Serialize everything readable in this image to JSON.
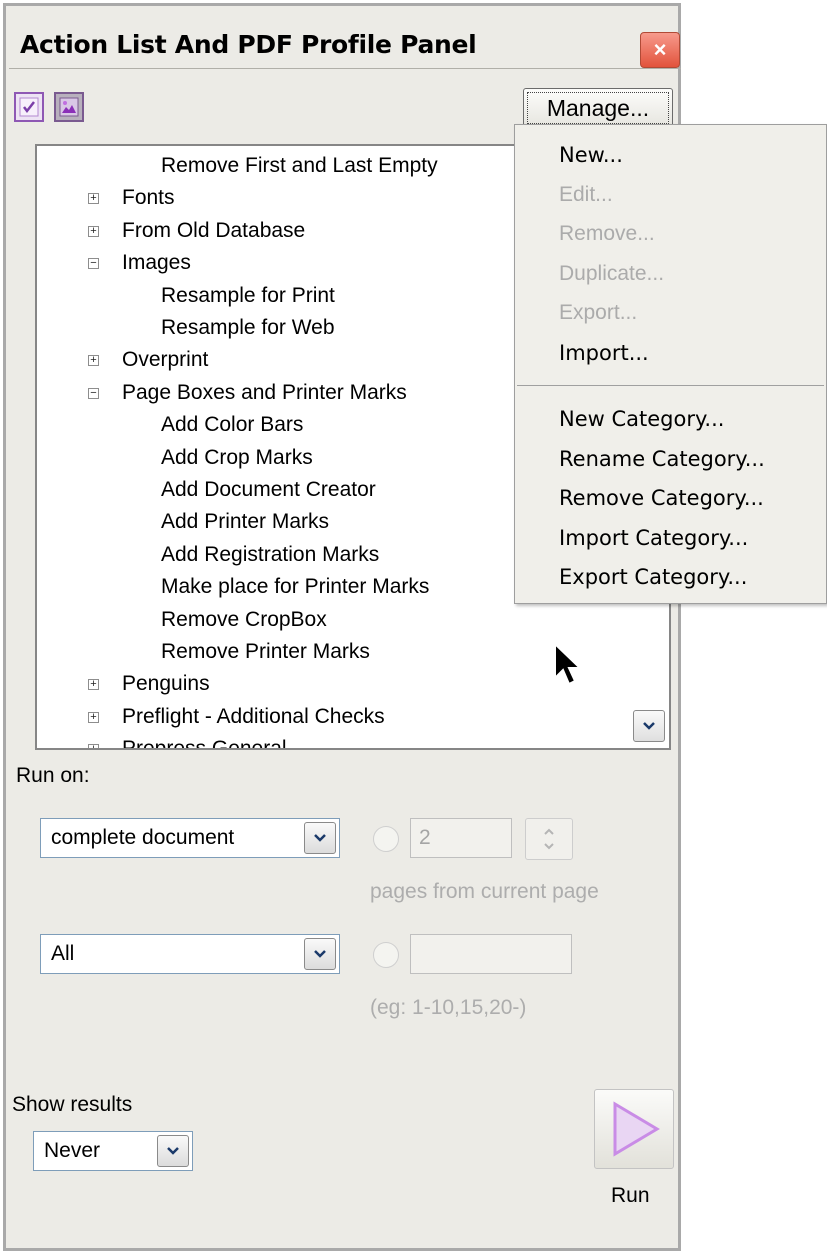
{
  "window": {
    "title": "Action List And PDF Profile Panel",
    "close_glyph": "×"
  },
  "toolbar": {
    "manage_label": "Manage...",
    "icons": [
      "checkmark-profile-icon",
      "image-profile-icon"
    ]
  },
  "tree": {
    "items": [
      {
        "label": "Remove First and Last Empty",
        "level": 2
      },
      {
        "label": "Fonts",
        "level": 1,
        "state": "collapsed"
      },
      {
        "label": "From Old Database",
        "level": 1,
        "state": "collapsed"
      },
      {
        "label": "Images",
        "level": 1,
        "state": "expanded"
      },
      {
        "label": "Resample for Print",
        "level": 2
      },
      {
        "label": "Resample for Web",
        "level": 2
      },
      {
        "label": "Overprint",
        "level": 1,
        "state": "collapsed"
      },
      {
        "label": "Page Boxes and Printer Marks",
        "level": 1,
        "state": "expanded"
      },
      {
        "label": "Add Color Bars",
        "level": 2
      },
      {
        "label": "Add Crop Marks",
        "level": 2
      },
      {
        "label": "Add Document Creator",
        "level": 2
      },
      {
        "label": "Add Printer Marks",
        "level": 2
      },
      {
        "label": "Add Registration Marks",
        "level": 2
      },
      {
        "label": "Make place for Printer Marks",
        "level": 2
      },
      {
        "label": "Remove CropBox",
        "level": 2
      },
      {
        "label": "Remove Printer Marks",
        "level": 2
      },
      {
        "label": "Penguins",
        "level": 1,
        "state": "collapsed"
      },
      {
        "label": "Preflight - Additional Checks",
        "level": 1,
        "state": "collapsed"
      },
      {
        "label": "Prepress General",
        "level": 1,
        "state": "collapsed"
      }
    ]
  },
  "manage_menu": {
    "items": [
      {
        "label": "New...",
        "enabled": true
      },
      {
        "label": "Edit...",
        "enabled": false
      },
      {
        "label": "Remove...",
        "enabled": false
      },
      {
        "label": "Duplicate...",
        "enabled": false
      },
      {
        "label": "Export...",
        "enabled": false
      },
      {
        "label": "Import...",
        "enabled": true
      },
      {
        "label": "New Category...",
        "enabled": true
      },
      {
        "label": "Rename Category...",
        "enabled": true
      },
      {
        "label": "Remove Category...",
        "enabled": true
      },
      {
        "label": "Import Category...",
        "enabled": true
      },
      {
        "label": "Export Category...",
        "enabled": true
      }
    ]
  },
  "run_on": {
    "label": "Run on:",
    "scope_value": "complete document",
    "page_count_value": "2",
    "page_count_hint": "pages from current page",
    "pages_value": "All",
    "page_range_value": "",
    "page_range_hint": "(eg: 1-10,15,20-)"
  },
  "results": {
    "label": "Show results",
    "value": "Never"
  },
  "run": {
    "label": "Run"
  },
  "colors": {
    "panel_bg": "#ecebe6",
    "close_red": "#e2533c",
    "run_triangle": "#c98ce6",
    "icon_purple": "#8e58b4"
  }
}
